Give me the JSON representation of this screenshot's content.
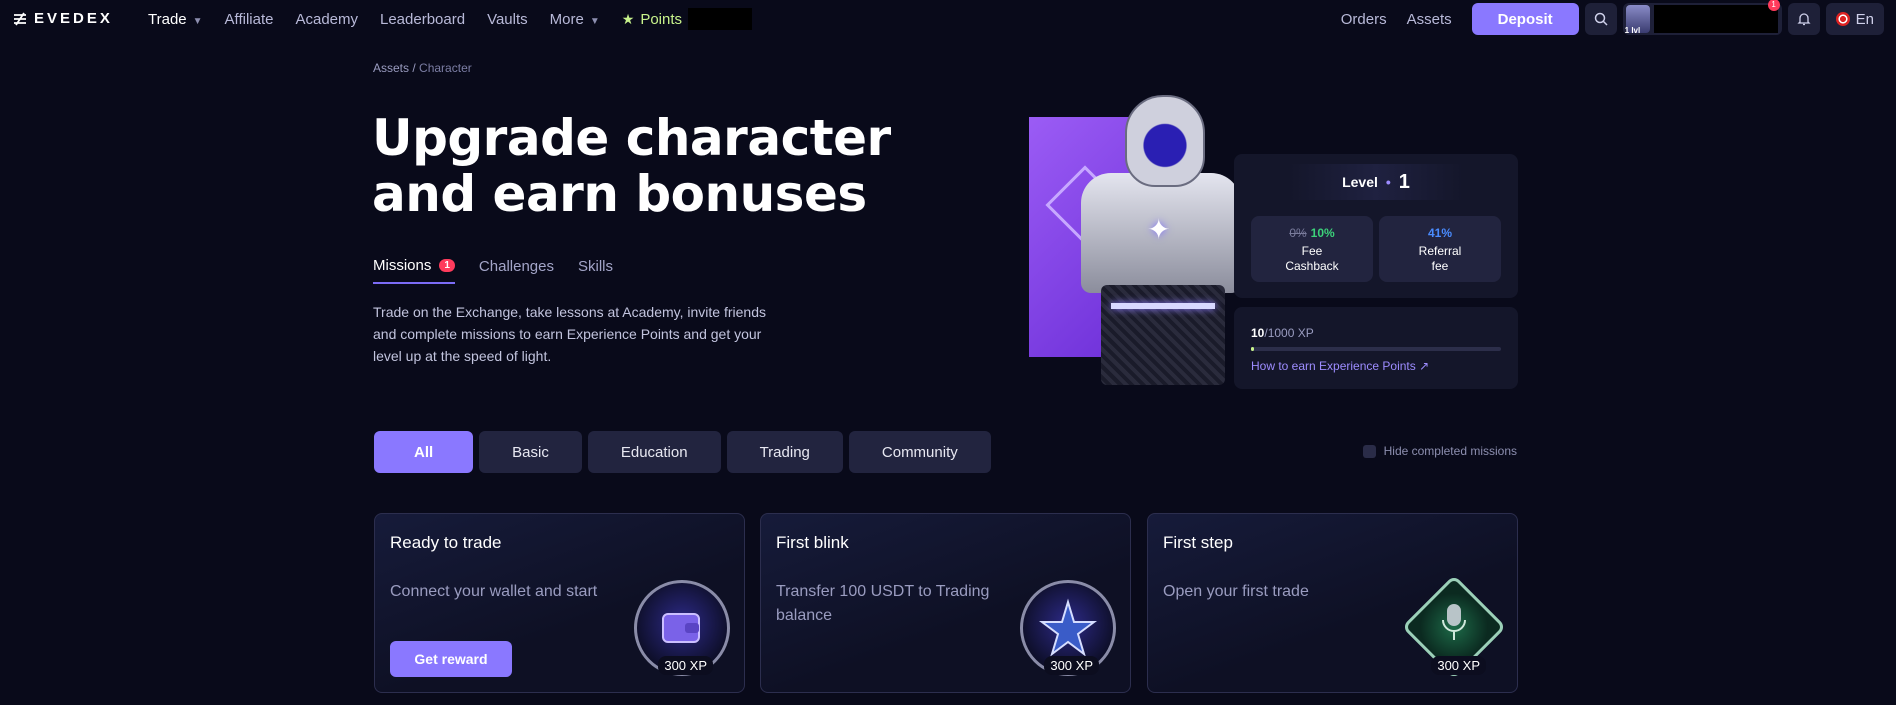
{
  "nav": {
    "logo": "EVEDEX",
    "links": [
      "Trade",
      "Affiliate",
      "Academy",
      "Leaderboard",
      "Vaults",
      "More"
    ],
    "points_label": "Points",
    "orders": "Orders",
    "assets": "Assets",
    "deposit": "Deposit",
    "avatar_level": "1 lvl",
    "notif_count": "1",
    "lang": "En"
  },
  "breadcrumb": {
    "parent": "Assets",
    "sep": "/",
    "current": "Character"
  },
  "hero": {
    "title_line1": "Upgrade character",
    "title_line2": "and earn bonuses",
    "description": "Trade on the Exchange, take lessons at Academy, invite friends and complete missions to earn Experience Points and get your level up at the speed of light."
  },
  "tabs": [
    {
      "label": "Missions",
      "count": "1"
    },
    {
      "label": "Challenges"
    },
    {
      "label": "Skills"
    }
  ],
  "level": {
    "label": "Level",
    "bullet": "•",
    "value": "1",
    "fee_old": "0%",
    "fee_new": "10%",
    "fee_label1": "Fee",
    "fee_label2": "Cashback",
    "ref_pct": "41%",
    "ref_label1": "Referral",
    "ref_label2": "fee",
    "xp_current": "10",
    "xp_total": "/1000 XP",
    "xp_progress": 0.01,
    "xp_link": "How to earn Experience Points ↗"
  },
  "filters": [
    "All",
    "Basic",
    "Education",
    "Trading",
    "Community"
  ],
  "hide_completed": "Hide completed missions",
  "missions": [
    {
      "title": "Ready to trade",
      "desc": "Connect your wallet and start",
      "button": "Get reward",
      "xp": "300 XP",
      "icon": "wallet-icon"
    },
    {
      "title": "First blink",
      "desc": "Transfer 100 USDT to Trading balance",
      "xp": "300 XP",
      "icon": "star-icon"
    },
    {
      "title": "First step",
      "desc": "Open your first trade",
      "xp": "300 XP",
      "icon": "microphone-icon"
    }
  ]
}
